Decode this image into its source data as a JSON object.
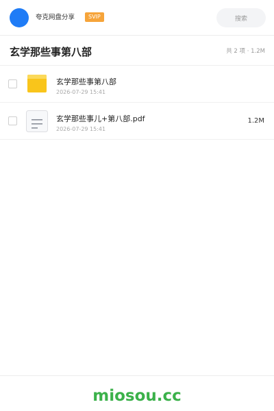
{
  "header": {
    "app_name": "夸克网盘分享",
    "badge": "SVIP",
    "search_placeholder": "搜索",
    "avatar_color": "#1f7cf6"
  },
  "folder": {
    "title": "玄学那些事第八部",
    "summary": "共 2 项 · 1.2M"
  },
  "files": [
    {
      "icon": "folder-icon",
      "name": "玄学那些事第八部",
      "time": "2026-07-29 15:41",
      "size": ""
    },
    {
      "icon": "document-icon",
      "name": "玄学那些事儿+第八部.pdf",
      "time": "2026-07-29 15:41",
      "size": "1.2M"
    }
  ],
  "footer": {
    "watermark": "miosou.cc",
    "watermark_color": "#3bb14a"
  }
}
